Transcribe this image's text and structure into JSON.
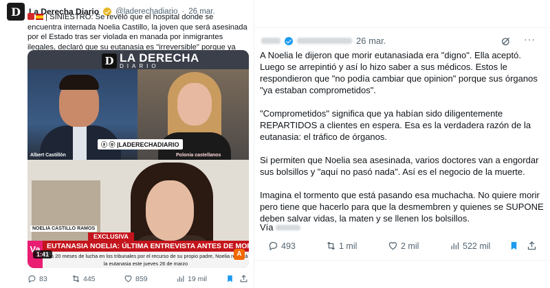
{
  "left_post": {
    "author": {
      "name": "La Derecha Diario",
      "handle": "@laderechadiario",
      "sep": "·",
      "time": "26 mar.",
      "avatar_letter": "D"
    },
    "text": "| SINIESTRO: Se reveló que el hospital donde se encuentra internada Noelia Castillo, la joven que será asesinada por el Estado tras ser violada en manada por inmigrantes ilegales, declaró que su eutanasia es \"irreversible\" porque ya destinaron los órganos que le extraerán tras su asesinato.",
    "media": {
      "brand_title": "LA DERECHA",
      "brand_sub": "DIARIO",
      "brand_letter": "D",
      "social_tag": "ⓧ ⓞ |LADERECHADIARIO",
      "person_left": "Albert Castillón",
      "person_right": "Polonia castellanos",
      "guest_tag": "NOELIA CASTILLO RAMOS",
      "exclusive": "EXCLUSIVA",
      "headline": "EUTANASIA NOELIA: ÚLTIMA ENTREVISTA ANTES DE MORIR",
      "subline": "Tras 20 meses de lucha en los tribunales por el recurso de su propio padre, Noelia recibirá la eutanasia este jueves 26 de marzo",
      "channel_logo": "Va",
      "timecode": "1:41",
      "channel_mark": "A"
    },
    "actions": {
      "replies": "83",
      "reposts": "445",
      "likes": "859",
      "views": "19 mil"
    }
  },
  "right_post": {
    "time": "26 mar.",
    "paragraphs": [
      "A Noelia le dijeron que morir eutanasiada era \"digno\". Ella aceptó. Luego se arrepintió y así lo hizo saber a sus médicos. Estos le respondieron que \"no podía cambiar que opinion\" porque sus órganos \"ya estaban comprometidos\".",
      "\"Comprometidos\" significa que ya habían sido diligentemente REPARTIDOS a clientes en espera. Esa es la verdadera razón de la eutanasia: el tráfico de órganos.",
      "Si permiten que Noelia sea asesinada, varios doctores van a engordar sus bolsillos y \"aquí no pasó nada\". Así es el negocio de la muerte.",
      "Imagina el tormento que está pasando esa muchacha. No quiere morir pero tiene que hacerlo para que la desmembren y quienes se SUPONE deben salvar vidas, la maten y se llenen los bolsillos."
    ],
    "via_label": "Vía",
    "more": "···",
    "actions": {
      "replies": "493",
      "reposts": "1 mil",
      "likes": "2 mil",
      "views": "522 mil"
    }
  },
  "colors": {
    "text": "#0f1419",
    "muted": "#536471",
    "accent": "#1d9bf0",
    "gold_verified": "#e8b82b",
    "red_banner": "#c4141c"
  },
  "icons": [
    "reply-icon",
    "repost-icon",
    "like-icon",
    "views-icon",
    "bookmark-icon",
    "share-icon",
    "grok-icon",
    "more-icon",
    "verified-icon"
  ]
}
